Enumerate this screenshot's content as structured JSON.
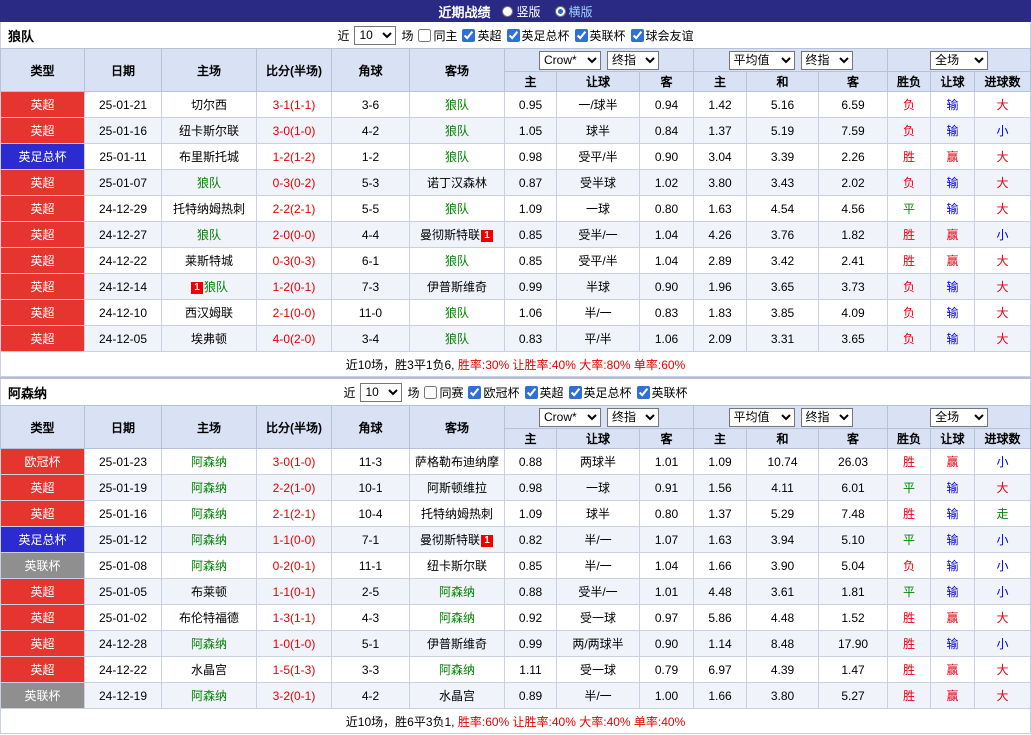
{
  "topbar": {
    "title": "近期战绩",
    "layout_options": [
      {
        "label": "竖版",
        "selected": false
      },
      {
        "label": "横版",
        "selected": true
      }
    ]
  },
  "columns": {
    "left": [
      "类型",
      "日期",
      "主场",
      "比分(半场)",
      "角球",
      "客场"
    ],
    "odds_group1": {
      "select_a": "Crow*",
      "select_b": "终指",
      "subcols": [
        "主",
        "让球",
        "客"
      ]
    },
    "odds_group2": {
      "select_a": "平均值",
      "select_b": "终指",
      "subcols": [
        "主",
        "和",
        "客"
      ]
    },
    "result_group": {
      "select_a": "全场",
      "subcols": [
        "胜负",
        "让球",
        "进球数"
      ]
    }
  },
  "league_colors": {
    "英超": "#e6352f",
    "英足总杯": "#2b2bd0",
    "英联杯": "#8f8f8f",
    "欧冠杯": "#e6352f"
  },
  "result_colors": {
    "胜": "#e60012",
    "平": "#008800",
    "负": "#e60012",
    "赢": "#e60012",
    "输": "#0000dd",
    "走": "#008800",
    "大": "#e60012",
    "小": "#0000dd"
  },
  "sections": [
    {
      "team": "狼队",
      "filter": {
        "prefix": "近",
        "count": "10",
        "suffix": "场",
        "unchecked": "同主",
        "checked": [
          "英超",
          "英足总杯",
          "英联杯",
          "球会友谊"
        ]
      },
      "rows": [
        {
          "league": "英超",
          "date": "25-01-21",
          "home": "切尔西",
          "home_team": false,
          "score": "3-1(1-1)",
          "corners": "3-6",
          "away": "狼队",
          "away_team": true,
          "h1": "0.95",
          "handicap": "一/球半",
          "h2": "0.94",
          "m1": "1.42",
          "m2": "5.16",
          "m3": "6.59",
          "res": "负",
          "hres": "输",
          "goals": "大"
        },
        {
          "league": "英超",
          "date": "25-01-16",
          "home": "纽卡斯尔联",
          "home_team": false,
          "score": "3-0(1-0)",
          "corners": "4-2",
          "away": "狼队",
          "away_team": true,
          "h1": "1.05",
          "handicap": "球半",
          "h2": "0.84",
          "m1": "1.37",
          "m2": "5.19",
          "m3": "7.59",
          "res": "负",
          "hres": "输",
          "goals": "小"
        },
        {
          "league": "英足总杯",
          "date": "25-01-11",
          "home": "布里斯托城",
          "home_team": false,
          "score": "1-2(1-2)",
          "corners": "1-2",
          "away": "狼队",
          "away_team": true,
          "h1": "0.98",
          "handicap": "受平/半",
          "h2": "0.90",
          "m1": "3.04",
          "m2": "3.39",
          "m3": "2.26",
          "res": "胜",
          "hres": "赢",
          "goals": "大"
        },
        {
          "league": "英超",
          "date": "25-01-07",
          "home": "狼队",
          "home_team": true,
          "score": "0-3(0-2)",
          "corners": "5-3",
          "away": "诺丁汉森林",
          "away_team": false,
          "h1": "0.87",
          "handicap": "受半球",
          "h2": "1.02",
          "m1": "3.80",
          "m2": "3.43",
          "m3": "2.02",
          "res": "负",
          "hres": "输",
          "goals": "大"
        },
        {
          "league": "英超",
          "date": "24-12-29",
          "home": "托特纳姆热刺",
          "home_team": false,
          "score": "2-2(2-1)",
          "corners": "5-5",
          "away": "狼队",
          "away_team": true,
          "h1": "1.09",
          "handicap": "一球",
          "h2": "0.80",
          "m1": "1.63",
          "m2": "4.54",
          "m3": "4.56",
          "res": "平",
          "hres": "输",
          "goals": "大"
        },
        {
          "league": "英超",
          "date": "24-12-27",
          "home": "狼队",
          "home_team": true,
          "score": "2-0(0-0)",
          "corners": "4-4",
          "away": "曼彻斯特联",
          "away_team": false,
          "away_card": "1",
          "away_card_pos": "after",
          "h1": "0.85",
          "handicap": "受半/一",
          "h2": "1.04",
          "m1": "4.26",
          "m2": "3.76",
          "m3": "1.82",
          "res": "胜",
          "hres": "赢",
          "goals": "小"
        },
        {
          "league": "英超",
          "date": "24-12-22",
          "home": "莱斯特城",
          "home_team": false,
          "score": "0-3(0-3)",
          "corners": "6-1",
          "away": "狼队",
          "away_team": true,
          "h1": "0.85",
          "handicap": "受平/半",
          "h2": "1.04",
          "m1": "2.89",
          "m2": "3.42",
          "m3": "2.41",
          "res": "胜",
          "hres": "赢",
          "goals": "大"
        },
        {
          "league": "英超",
          "date": "24-12-14",
          "home": "狼队",
          "home_team": true,
          "home_card": "1",
          "home_card_pos": "before",
          "score": "1-2(0-1)",
          "corners": "7-3",
          "away": "伊普斯维奇",
          "away_team": false,
          "h1": "0.99",
          "handicap": "半球",
          "h2": "0.90",
          "m1": "1.96",
          "m2": "3.65",
          "m3": "3.73",
          "res": "负",
          "hres": "输",
          "goals": "大"
        },
        {
          "league": "英超",
          "date": "24-12-10",
          "home": "西汉姆联",
          "home_team": false,
          "score": "2-1(0-0)",
          "corners": "11-0",
          "away": "狼队",
          "away_team": true,
          "h1": "1.06",
          "handicap": "半/一",
          "h2": "0.83",
          "m1": "1.83",
          "m2": "3.85",
          "m3": "4.09",
          "res": "负",
          "hres": "输",
          "goals": "大"
        },
        {
          "league": "英超",
          "date": "24-12-05",
          "home": "埃弗顿",
          "home_team": false,
          "score": "4-0(2-0)",
          "corners": "3-4",
          "away": "狼队",
          "away_team": true,
          "h1": "0.83",
          "handicap": "平/半",
          "h2": "1.06",
          "m1": "2.09",
          "m2": "3.31",
          "m3": "3.65",
          "res": "负",
          "hres": "输",
          "goals": "大"
        }
      ],
      "summary": {
        "black": "近10场，胜3平1负6,",
        "red": "胜率:30% 让胜率:40% 大率:80% 单率:60%"
      }
    },
    {
      "team": "阿森纳",
      "filter": {
        "prefix": "近",
        "count": "10",
        "suffix": "场",
        "unchecked": "同赛",
        "checked": [
          "欧冠杯",
          "英超",
          "英足总杯",
          "英联杯"
        ]
      },
      "rows": [
        {
          "league": "欧冠杯",
          "date": "25-01-23",
          "home": "阿森纳",
          "home_team": true,
          "score": "3-0(1-0)",
          "corners": "11-3",
          "away": "萨格勒布迪纳摩",
          "away_team": false,
          "h1": "0.88",
          "handicap": "两球半",
          "h2": "1.01",
          "m1": "1.09",
          "m2": "10.74",
          "m3": "26.03",
          "res": "胜",
          "hres": "赢",
          "goals": "小"
        },
        {
          "league": "英超",
          "date": "25-01-19",
          "home": "阿森纳",
          "home_team": true,
          "score": "2-2(1-0)",
          "corners": "10-1",
          "away": "阿斯顿维拉",
          "away_team": false,
          "h1": "0.98",
          "handicap": "一球",
          "h2": "0.91",
          "m1": "1.56",
          "m2": "4.11",
          "m3": "6.01",
          "res": "平",
          "hres": "输",
          "goals": "大"
        },
        {
          "league": "英超",
          "date": "25-01-16",
          "home": "阿森纳",
          "home_team": true,
          "score": "2-1(2-1)",
          "corners": "10-4",
          "away": "托特纳姆热刺",
          "away_team": false,
          "h1": "1.09",
          "handicap": "球半",
          "h2": "0.80",
          "m1": "1.37",
          "m2": "5.29",
          "m3": "7.48",
          "res": "胜",
          "hres": "输",
          "goals": "走"
        },
        {
          "league": "英足总杯",
          "date": "25-01-12",
          "home": "阿森纳",
          "home_team": true,
          "score": "1-1(0-0)",
          "corners": "7-1",
          "away": "曼彻斯特联",
          "away_team": false,
          "away_card": "1",
          "away_card_pos": "after",
          "h1": "0.82",
          "handicap": "半/一",
          "h2": "1.07",
          "m1": "1.63",
          "m2": "3.94",
          "m3": "5.10",
          "res": "平",
          "hres": "输",
          "goals": "小"
        },
        {
          "league": "英联杯",
          "date": "25-01-08",
          "home": "阿森纳",
          "home_team": true,
          "score": "0-2(0-1)",
          "corners": "11-1",
          "away": "纽卡斯尔联",
          "away_team": false,
          "h1": "0.85",
          "handicap": "半/一",
          "h2": "1.04",
          "m1": "1.66",
          "m2": "3.90",
          "m3": "5.04",
          "res": "负",
          "hres": "输",
          "goals": "小"
        },
        {
          "league": "英超",
          "date": "25-01-05",
          "home": "布莱顿",
          "home_team": false,
          "score": "1-1(0-1)",
          "corners": "2-5",
          "away": "阿森纳",
          "away_team": true,
          "h1": "0.88",
          "handicap": "受半/一",
          "h2": "1.01",
          "m1": "4.48",
          "m2": "3.61",
          "m3": "1.81",
          "res": "平",
          "hres": "输",
          "goals": "小"
        },
        {
          "league": "英超",
          "date": "25-01-02",
          "home": "布伦特福德",
          "home_team": false,
          "score": "1-3(1-1)",
          "corners": "4-3",
          "away": "阿森纳",
          "away_team": true,
          "h1": "0.92",
          "handicap": "受一球",
          "h2": "0.97",
          "m1": "5.86",
          "m2": "4.48",
          "m3": "1.52",
          "res": "胜",
          "hres": "赢",
          "goals": "大"
        },
        {
          "league": "英超",
          "date": "24-12-28",
          "home": "阿森纳",
          "home_team": true,
          "score": "1-0(1-0)",
          "corners": "5-1",
          "away": "伊普斯维奇",
          "away_team": false,
          "h1": "0.99",
          "handicap": "两/两球半",
          "h2": "0.90",
          "m1": "1.14",
          "m2": "8.48",
          "m3": "17.90",
          "res": "胜",
          "hres": "输",
          "goals": "小"
        },
        {
          "league": "英超",
          "date": "24-12-22",
          "home": "水晶宫",
          "home_team": false,
          "score": "1-5(1-3)",
          "corners": "3-3",
          "away": "阿森纳",
          "away_team": true,
          "h1": "1.11",
          "handicap": "受一球",
          "h2": "0.79",
          "m1": "6.97",
          "m2": "4.39",
          "m3": "1.47",
          "res": "胜",
          "hres": "赢",
          "goals": "大"
        },
        {
          "league": "英联杯",
          "date": "24-12-19",
          "home": "阿森纳",
          "home_team": true,
          "score": "3-2(0-1)",
          "corners": "4-2",
          "away": "水晶宫",
          "away_team": false,
          "h1": "0.89",
          "handicap": "半/一",
          "h2": "1.00",
          "m1": "1.66",
          "m2": "3.80",
          "m3": "5.27",
          "res": "胜",
          "hres": "赢",
          "goals": "大"
        }
      ],
      "summary": {
        "black": "近10场，胜6平3负1,",
        "red": "胜率:60% 让胜率:40% 大率:40% 单率:40%"
      }
    }
  ]
}
